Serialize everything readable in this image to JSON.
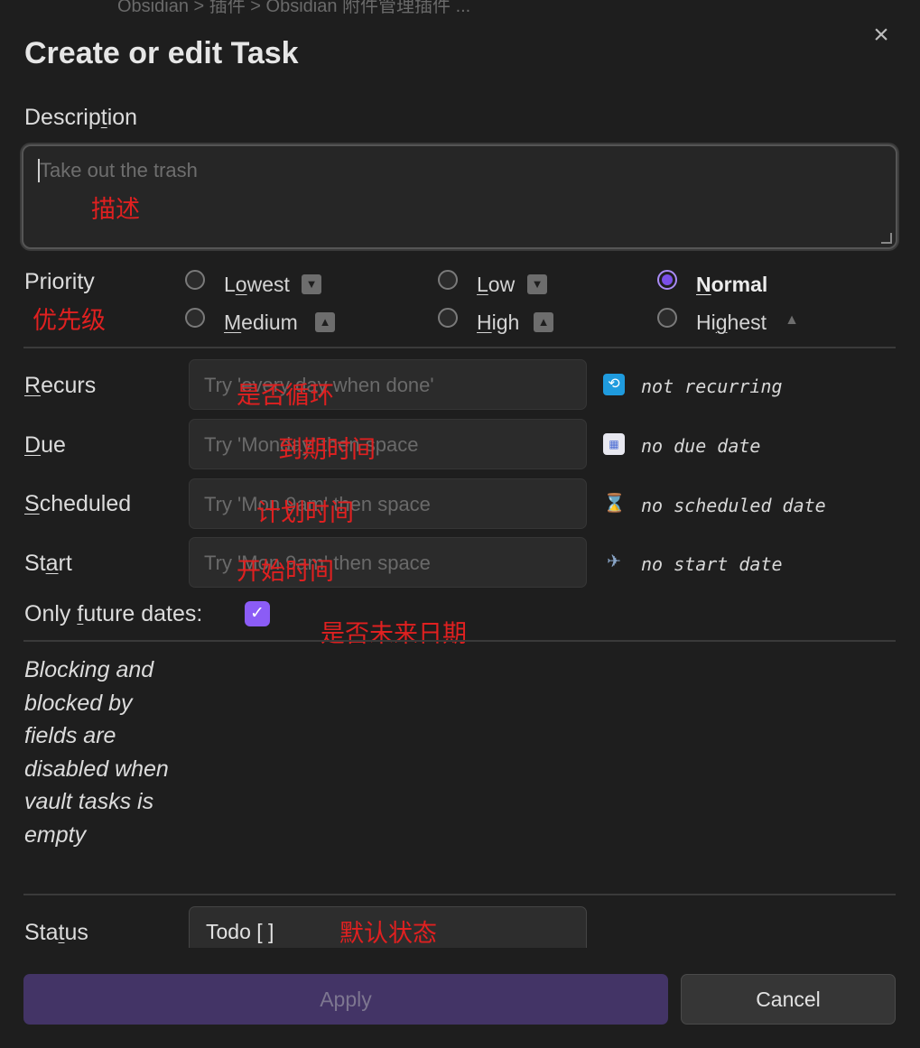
{
  "background_text": "Obsidian > 插件 > Obsidian 附件管理插件 ...",
  "modal": {
    "title": "Create or edit Task",
    "close_icon": "×"
  },
  "description": {
    "label": "Description",
    "placeholder": "Take out the trash",
    "annotation": "描述"
  },
  "priority": {
    "label": "Priority",
    "annotation": "优先级",
    "options": [
      {
        "label": "Lowest",
        "icon": "⏬",
        "selected": false
      },
      {
        "label": "Low",
        "icon": "🔽",
        "selected": false
      },
      {
        "label": "Normal",
        "icon": "",
        "selected": true
      },
      {
        "label": "Medium",
        "icon": "🔼",
        "selected": false
      },
      {
        "label": "High",
        "icon": "⏫",
        "selected": false
      },
      {
        "label": "Highest",
        "icon": "🔺",
        "selected": false
      }
    ]
  },
  "dates": {
    "recurs": {
      "label": "Recurs",
      "placeholder": "Try 'every day when done'",
      "status": "not recurring",
      "annotation": "是否循环",
      "icon": "repeat-icon",
      "icon_color": "#1f9bde"
    },
    "due": {
      "label": "Due",
      "placeholder": "Try 'Monday' then space",
      "status": "no due date",
      "annotation": "到期时间",
      "icon": "calendar-icon",
      "icon_color": "#e8e8f0"
    },
    "scheduled": {
      "label": "Scheduled",
      "placeholder": "Try 'Mon 9am' then space",
      "status": "no scheduled date",
      "annotation": "计划时间",
      "icon": "hourglass-icon",
      "icon_color": "#e0a82e"
    },
    "start": {
      "label": "Start",
      "placeholder": "Try 'Mon 9am' then space",
      "status": "no start date",
      "annotation": "开始时间",
      "icon": "airplane-departure-icon",
      "icon_color": "#8aa6c8"
    }
  },
  "only_future": {
    "label": "Only future dates:",
    "checked": true,
    "annotation": "是否未来日期"
  },
  "blocking_note": "Blocking and blocked by fields are disabled when vault tasks is empty",
  "status": {
    "label": "Status",
    "value": "Todo [ ]",
    "annotation": "默认状态"
  },
  "buttons": {
    "apply": "Apply",
    "cancel": "Cancel"
  },
  "colors": {
    "accent": "#8b5cf6",
    "annotation_red": "#e02020",
    "background": "#1e1e1e"
  }
}
